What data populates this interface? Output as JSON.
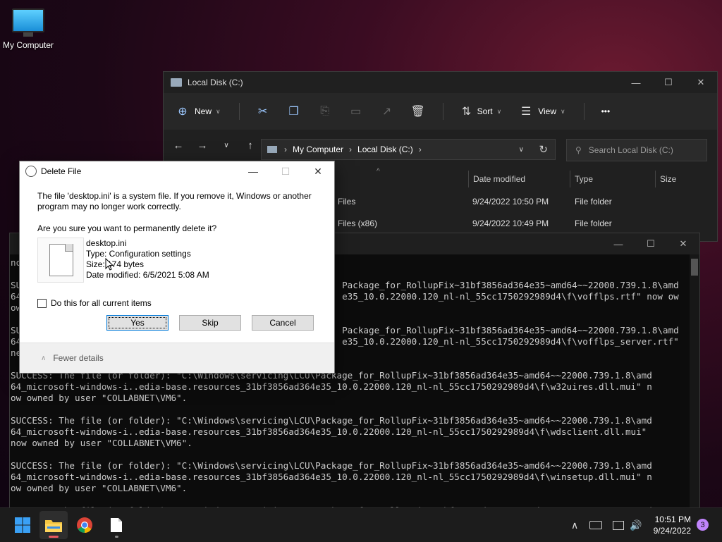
{
  "desktop": {
    "icon_label": "My Computer"
  },
  "explorer": {
    "title": "Local Disk (C:)",
    "toolbar": {
      "new_label": "New",
      "sort_label": "Sort",
      "view_label": "View",
      "more_label": "•••"
    },
    "breadcrumb": [
      "My Computer",
      "Local Disk (C:)"
    ],
    "search_placeholder": "Search Local Disk (C:)",
    "columns": {
      "date_modified": "Date modified",
      "type": "Type",
      "size": "Size"
    },
    "rows": [
      {
        "name": "Files",
        "date": "9/24/2022 10:50 PM",
        "type": "File folder"
      },
      {
        "name": "Files (x86)",
        "date": "9/24/2022 10:49 PM",
        "type": "File folder"
      }
    ]
  },
  "console": {
    "text": "no\n\nSU                                                            Package_for_RollupFix~31bf3856ad364e35~amd64~~22000.739.1.8\\amd\n64                                                            e35_10.0.22000.120_nl-nl_55cc1750292989d4\\f\\vofflps.rtf\" now ow\now\n\nSU                                                            Package_for_RollupFix~31bf3856ad364e35~amd64~~22000.739.1.8\\amd\n64                                                            e35_10.0.22000.120_nl-nl_55cc1750292989d4\\f\\vofflps_server.rtf\"\nne\n\nSUCCESS: The file (or folder): \"C:\\Windows\\servicing\\LCU\\Package_for_RollupFix~31bf3856ad364e35~amd64~~22000.739.1.8\\amd\n64_microsoft-windows-i..edia-base.resources_31bf3856ad364e35_10.0.22000.120_nl-nl_55cc1750292989d4\\f\\w32uires.dll.mui\" n\now owned by user \"COLLABNET\\VM6\".\n\nSUCCESS: The file (or folder): \"C:\\Windows\\servicing\\LCU\\Package_for_RollupFix~31bf3856ad364e35~amd64~~22000.739.1.8\\amd\n64_microsoft-windows-i..edia-base.resources_31bf3856ad364e35_10.0.22000.120_nl-nl_55cc1750292989d4\\f\\wdsclient.dll.mui\"\nnow owned by user \"COLLABNET\\VM6\".\n\nSUCCESS: The file (or folder): \"C:\\Windows\\servicing\\LCU\\Package_for_RollupFix~31bf3856ad364e35~amd64~~22000.739.1.8\\amd\n64_microsoft-windows-i..edia-base.resources_31bf3856ad364e35_10.0.22000.120_nl-nl_55cc1750292989d4\\f\\winsetup.dll.mui\" n\now owned by user \"COLLABNET\\VM6\".\n\nSUCCESS: The file (or folder): \"C:\\Windows\\servicing\\LCU\\Package_for_RollupFix~31bf3856ad364e35~amd64~~22000.739.1.8\\amd"
  },
  "dialog": {
    "title": "Delete File",
    "message": "The file 'desktop.ini' is a system file. If you remove it, Windows or another program may no longer work correctly.",
    "question": "Are you sure you want to permanently delete it?",
    "file_name": "desktop.ini",
    "file_type": "Type: Configuration settings",
    "file_size": "Size: 174 bytes",
    "file_date": "Date modified: 6/5/2021 5:08 AM",
    "checkbox_label": "Do this for all current items",
    "yes_label": "Yes",
    "skip_label": "Skip",
    "cancel_label": "Cancel",
    "fewer_details_label": "Fewer details"
  },
  "taskbar": {
    "time": "10:51 PM",
    "date": "9/24/2022",
    "notification_count": "3"
  }
}
